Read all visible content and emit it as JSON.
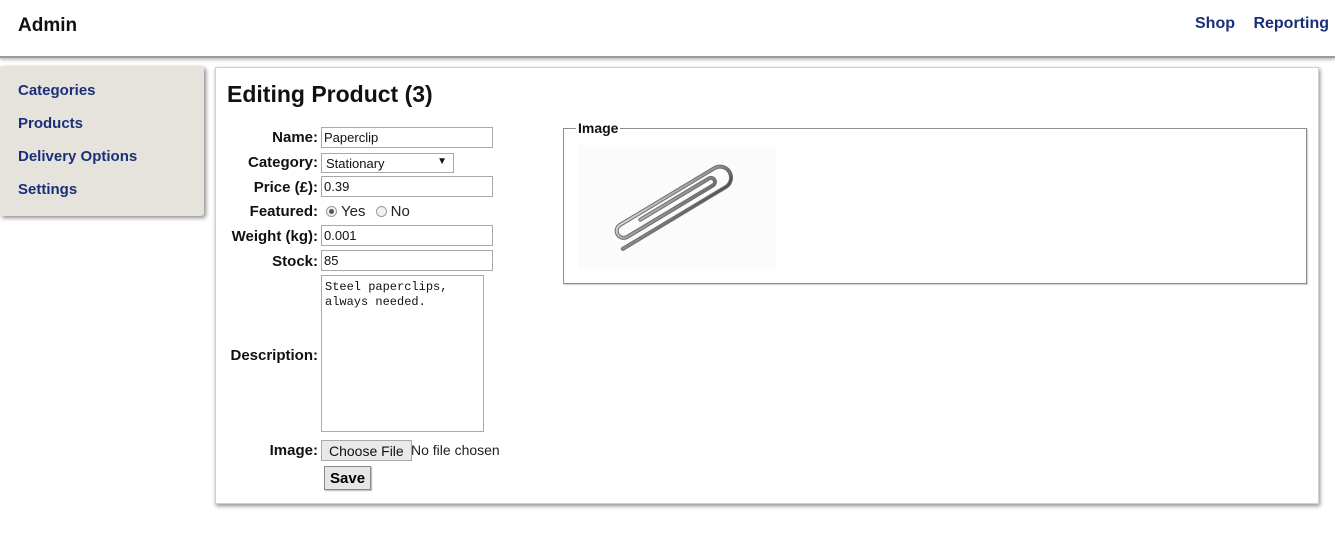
{
  "header": {
    "brand": "Admin",
    "nav": [
      "Shop",
      "Reporting"
    ]
  },
  "sidebar": {
    "items": [
      "Categories",
      "Products",
      "Delivery Options",
      "Settings"
    ]
  },
  "page": {
    "title": "Editing Product (3)",
    "form": {
      "name_label": "Name:",
      "name_value": "Paperclip",
      "category_label": "Category:",
      "category_value": "Stationary",
      "price_label": "Price (£):",
      "price_value": "0.39",
      "featured_label": "Featured:",
      "featured_yes": "Yes",
      "featured_no": "No",
      "featured_selected": "Yes",
      "weight_label": "Weight (kg):",
      "weight_value": "0.001",
      "stock_label": "Stock:",
      "stock_value": "85",
      "description_label": "Description:",
      "description_value": "Steel paperclips,\nalways needed.",
      "image_label": "Image:",
      "choose_file": "Choose File",
      "no_file": "No file chosen",
      "save": "Save"
    },
    "image_panel": {
      "legend": "Image",
      "icon": "paperclip-image"
    }
  }
}
